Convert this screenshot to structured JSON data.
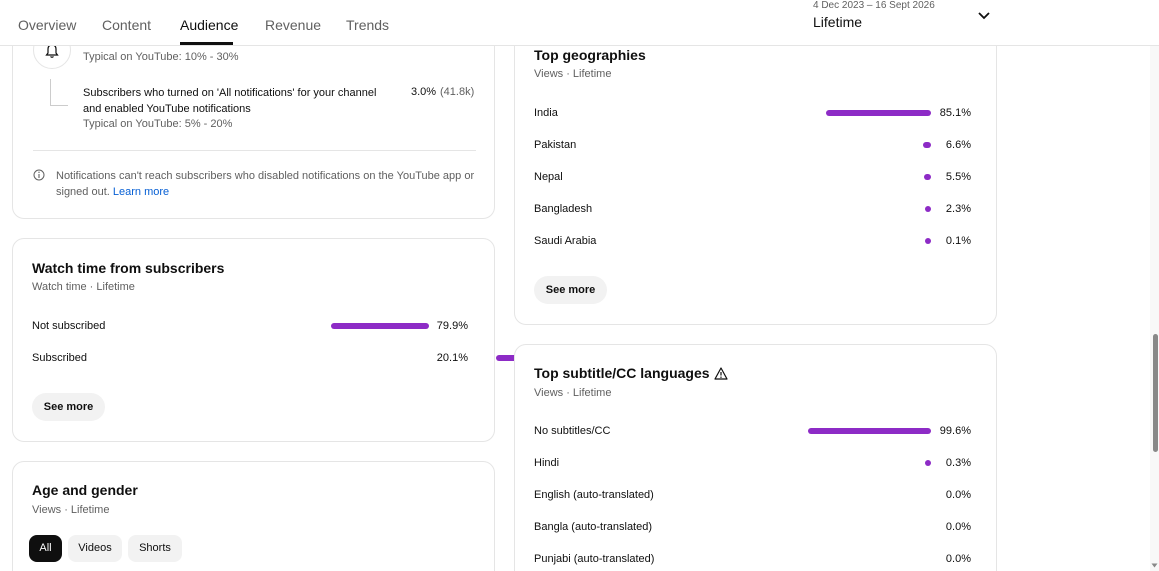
{
  "nav": {
    "tabs": [
      "Overview",
      "Content",
      "Audience",
      "Revenue",
      "Trends"
    ],
    "active_tab": "Audience",
    "date_range": "4 Dec 2023 – 16 Sept 2026",
    "range_label": "Lifetime"
  },
  "notifications": {
    "typical_top": "Typical on YouTube: 10% - 30%",
    "all_notif_label": "Subscribers who turned on 'All notifications' for your channel and enabled YouTube notifications",
    "all_notif_value": "3.0%",
    "all_notif_count": "(41.8k)",
    "all_notif_typical": "Typical on YouTube: 5% - 20%",
    "info_text": "Notifications can't reach subscribers who disabled notifications on the YouTube app or signed out.",
    "learn_more": "Learn more"
  },
  "watch_time": {
    "title": "Watch time from subscribers",
    "subtitle": "Watch time · Lifetime",
    "rows": [
      {
        "label": "Not subscribed",
        "value": "79.9%",
        "pct": 79.9
      },
      {
        "label": "Subscribed",
        "value": "20.1%",
        "pct": 20.1
      }
    ],
    "see_more": "See more"
  },
  "age_gender": {
    "title": "Age and gender",
    "subtitle": "Views · Lifetime",
    "chips": [
      "All",
      "Videos",
      "Shorts"
    ],
    "active_chip": "All"
  },
  "geographies": {
    "title": "Top geographies",
    "subtitle": "Views · Lifetime",
    "rows": [
      {
        "label": "India",
        "value": "85.1%",
        "pct": 85.1
      },
      {
        "label": "Pakistan",
        "value": "6.6%",
        "pct": 6.6
      },
      {
        "label": "Nepal",
        "value": "5.5%",
        "pct": 5.5
      },
      {
        "label": "Bangladesh",
        "value": "2.3%",
        "pct": 2.3
      },
      {
        "label": "Saudi Arabia",
        "value": "0.1%",
        "pct": 0.1
      }
    ],
    "see_more": "See more"
  },
  "subtitles": {
    "title": "Top subtitle/CC languages",
    "subtitle": "Views · Lifetime",
    "rows": [
      {
        "label": "No subtitles/CC",
        "value": "99.6%",
        "pct": 99.6
      },
      {
        "label": "Hindi",
        "value": "0.3%",
        "pct": 0.3
      },
      {
        "label": "English (auto-translated)",
        "value": "0.0%",
        "pct": 0.0
      },
      {
        "label": "Bangla (auto-translated)",
        "value": "0.0%",
        "pct": 0.0
      },
      {
        "label": "Punjabi (auto-translated)",
        "value": "0.0%",
        "pct": 0.0
      }
    ]
  },
  "colors": {
    "bar": "#8d2bc6",
    "link": "#065fd4"
  }
}
